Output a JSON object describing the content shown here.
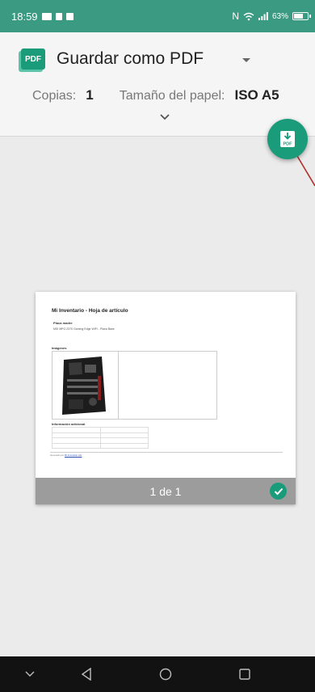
{
  "status_bar": {
    "time": "18:59",
    "battery": "63%"
  },
  "header": {
    "printer_icon_text": "PDF",
    "printer_name": "Guardar como PDF",
    "copies_label": "Copias:",
    "copies_value": "1",
    "paper_label": "Tamaño del papel:",
    "paper_value": "ISO A5"
  },
  "fab": {
    "icon": "pdf-download-icon",
    "text": "PDF"
  },
  "preview": {
    "doc_title": "Mi Inventario - Hoja de artículo",
    "doc_item_name": "Placa madre",
    "doc_item_desc": "MSI MPG Z370 Gaming Edge WIFI - Placa Base",
    "doc_images_heading": "Imágenes",
    "doc_info_heading": "Información adicional",
    "doc_footer_prefix": "Generado por",
    "doc_footer_link": "Mi Inventario Lite",
    "page_counter": "1 de 1",
    "selected": true
  },
  "colors": {
    "accent": "#1a9b7a",
    "status_bar": "#3a9a82",
    "nav_bar": "#121212"
  }
}
